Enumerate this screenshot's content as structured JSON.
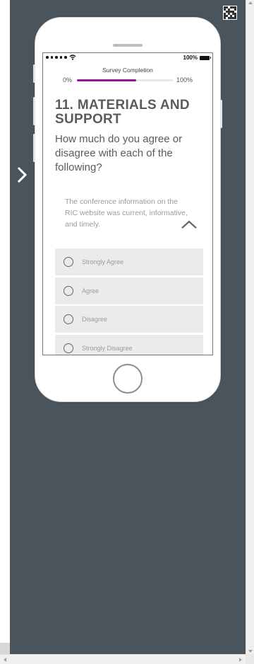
{
  "status_bar": {
    "battery_percent": "100%",
    "signal_dots": 5,
    "wifi_icon": "wifi-icon"
  },
  "progress": {
    "title": "Survey Completion",
    "start_label": "0%",
    "end_label": "100%",
    "value": 0.62,
    "color": "#8e1a99"
  },
  "question": {
    "title": "11.  MATERIALS AND SUPPORT",
    "subtitle": "How much do you agree or disagree with each of the following?"
  },
  "statement": {
    "text": "The conference information on the RIC website was current, informative, and timely."
  },
  "options": [
    {
      "label": "Strongly Agree"
    },
    {
      "label": "Agree"
    },
    {
      "label": "Disagree"
    },
    {
      "label": "Strongly Disagree"
    }
  ],
  "colors": {
    "background": "#4a545c",
    "phone": "#ffffff",
    "accent": "#8e1a99",
    "option_bg": "#ebebeb"
  }
}
